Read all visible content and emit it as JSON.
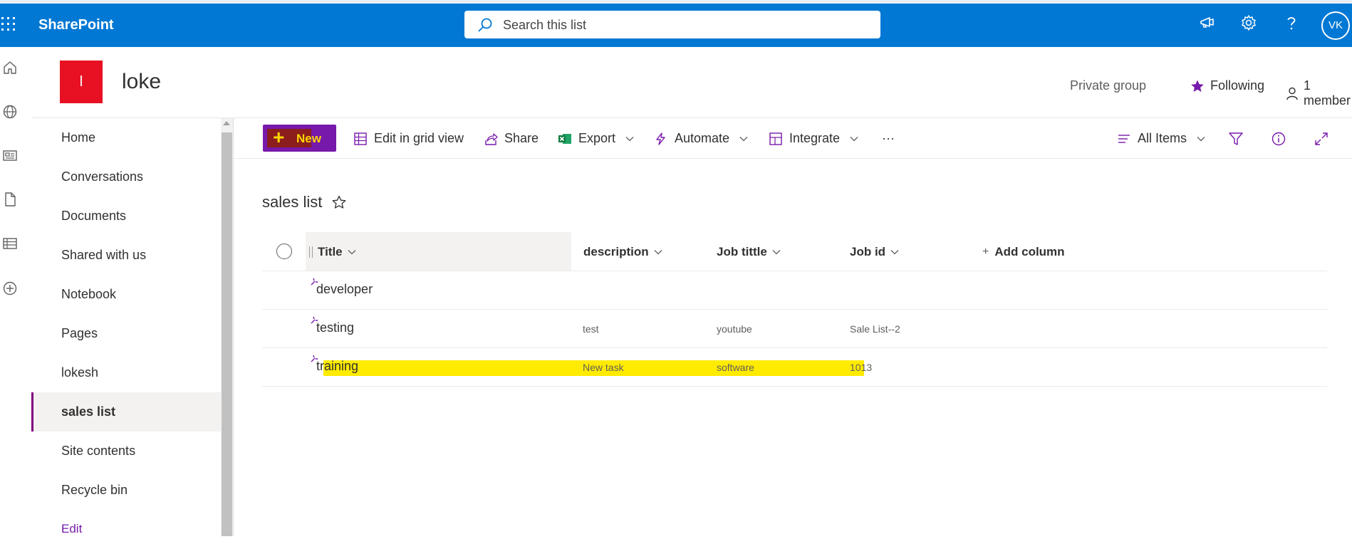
{
  "suitebar": {
    "brand": "SharePoint",
    "search_placeholder": "Search this list",
    "avatar_initials": "VK"
  },
  "site": {
    "logo_letter": "l",
    "title": "loke",
    "privacy": "Private group",
    "following": "Following",
    "members": "1 member"
  },
  "nav": {
    "items": [
      {
        "label": "Home"
      },
      {
        "label": "Conversations"
      },
      {
        "label": "Documents"
      },
      {
        "label": "Shared with us"
      },
      {
        "label": "Notebook"
      },
      {
        "label": "Pages"
      },
      {
        "label": "lokesh"
      },
      {
        "label": "sales list",
        "active": true
      },
      {
        "label": "Site contents"
      },
      {
        "label": "Recycle bin"
      }
    ],
    "edit": "Edit"
  },
  "command_bar": {
    "new": "New",
    "edit_grid": "Edit in grid view",
    "share": "Share",
    "export": "Export",
    "automate": "Automate",
    "integrate": "Integrate",
    "more": "···",
    "view": "All Items"
  },
  "list": {
    "title": "sales list",
    "columns": [
      "Title",
      "description",
      "Job tittle",
      "Job id"
    ],
    "add_column": "Add column",
    "rows": [
      {
        "title": "developer",
        "description": "",
        "job_title": "",
        "job_id": "",
        "highlighted": false
      },
      {
        "title": "testing",
        "description": "test",
        "job_title": "youtube",
        "job_id": "Sale List--2",
        "highlighted": false
      },
      {
        "title": "training",
        "description": "New task",
        "job_title": "software",
        "job_id": "1013",
        "highlighted": true
      }
    ]
  },
  "colors": {
    "suitebar": "#0078d4",
    "accent": "#7719aa",
    "logo": "#e81123",
    "highlight": "#ffeb00"
  }
}
